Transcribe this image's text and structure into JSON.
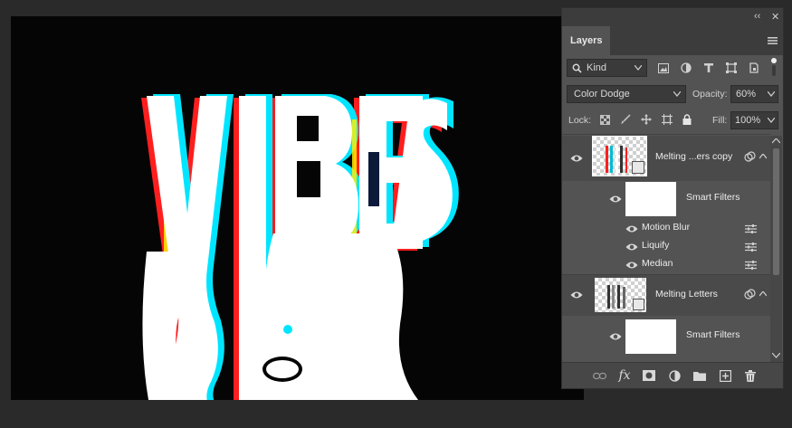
{
  "canvas": {
    "artwork_text": "VIBES"
  },
  "panel": {
    "collapse_label": "‹‹",
    "close_label": "✕",
    "tab_label": "Layers",
    "filter": {
      "kind_label": "Kind"
    },
    "blend_mode": "Color Dodge",
    "opacity_label": "Opacity:",
    "opacity_value": "60%",
    "lock_label": "Lock:",
    "fill_label": "Fill:",
    "fill_value": "100%",
    "layers": [
      {
        "name": "Melting ...ers copy",
        "smart_filters_label": "Smart Filters",
        "filters": [
          "Motion Blur",
          "Liquify",
          "Median"
        ]
      },
      {
        "name": "Melting Letters",
        "smart_filters_label": "Smart Filters"
      }
    ]
  },
  "colors": {
    "panel_bg": "#535353",
    "selected_row": "#4a4a4a",
    "canvas_bg": "#050505",
    "accent_red": "#ff1e1e",
    "accent_cyan": "#00e5ff",
    "accent_yellow": "#ffee00"
  }
}
